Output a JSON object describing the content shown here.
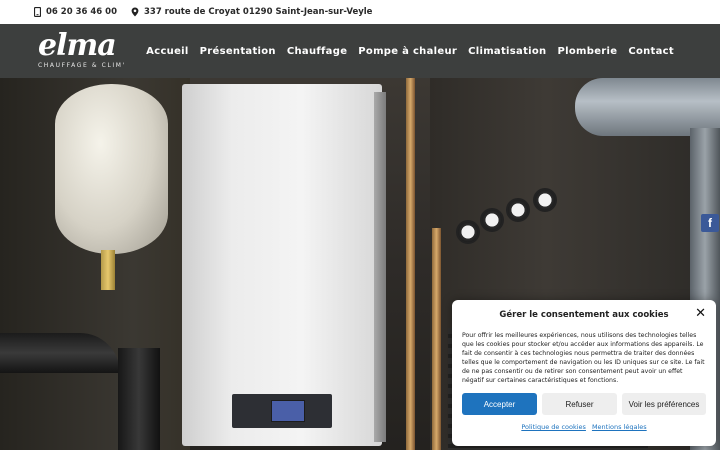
{
  "topbar": {
    "phone": "06 20 36 46 00",
    "address": "337 route de Croyat 01290 Saint-Jean-sur-Veyle"
  },
  "logo": {
    "word": "elma",
    "tagline": "CHAUFFAGE & CLIM'"
  },
  "nav": {
    "items": [
      "Accueil",
      "Présentation",
      "Chauffage",
      "Pompe à chaleur",
      "Climatisation",
      "Plomberie",
      "Contact"
    ]
  },
  "social": {
    "facebook_glyph": "f"
  },
  "cookie": {
    "title": "Gérer le consentement aux cookies",
    "body": "Pour offrir les meilleures expériences, nous utilisons des technologies telles que les cookies pour stocker et/ou accéder aux informations des appareils. Le fait de consentir à ces technologies nous permettra de traiter des données telles que le comportement de navigation ou les ID uniques sur ce site. Le fait de ne pas consentir ou de retirer son consentement peut avoir un effet négatif sur certaines caractéristiques et fonctions.",
    "accept_label": "Accepter",
    "deny_label": "Refuser",
    "prefs_label": "Voir les préférences",
    "policy_link": "Politique de cookies",
    "legal_link": "Mentions légales"
  },
  "colors": {
    "header_bg": "#3d3f3e",
    "accent": "#1e73be",
    "facebook": "#3b5998"
  }
}
